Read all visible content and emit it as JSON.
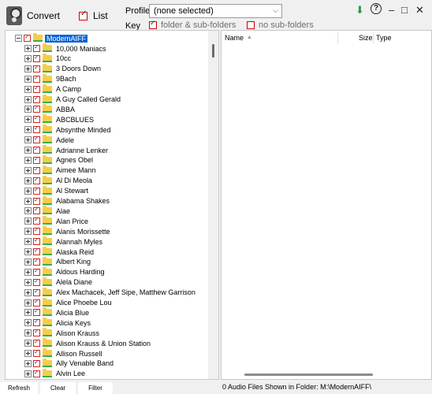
{
  "toolbar": {
    "convert_label": "Convert",
    "list_label": "List",
    "profile_label": "Profile",
    "profile_value": "(none selected)",
    "key_label": "Key",
    "key_folder_sub": "folder & sub-folders",
    "key_no_sub": "no sub-folders"
  },
  "tree": {
    "root": "ModernAIFF",
    "items": [
      "10,000 Maniacs",
      "10cc",
      "3 Doors Down",
      "9Bach",
      "A Camp",
      "A Guy Called Gerald",
      "ABBA",
      "ABCBLUES",
      "Absynthe Minded",
      "Adele",
      "Adrianne Lenker",
      "Agnes Obel",
      "Aimee Mann",
      "Al Di Meola",
      "Al Stewart",
      "Alabama Shakes",
      "Alae",
      "Alan Price",
      "Alanis Morissette",
      "Alannah Myles",
      "Alaska Reid",
      "Albert King",
      "Aldous Harding",
      "Alela Diane",
      "Alex Machacek, Jeff Sipe, Matthew Garrison",
      "Alice Phoebe Lou",
      "Alicia Blue",
      "Alicia Keys",
      "Alison Krauss",
      "Alison Krauss & Union Station",
      "Allison Russell",
      "Ally Venable Band",
      "Alvin Lee"
    ]
  },
  "list": {
    "columns": [
      "Name",
      "Size",
      "Type"
    ]
  },
  "bottom": {
    "refresh": "Refresh",
    "clear": "Clear",
    "filter": "Filter",
    "status": "0 Audio Files Shown in Folder: M:\\ModernAIFF\\"
  },
  "colors": {
    "selection": "#0a64d6",
    "folder": "#f6cd4a",
    "check_border": "#dd2222",
    "download_icon": "#2e9a4a"
  }
}
